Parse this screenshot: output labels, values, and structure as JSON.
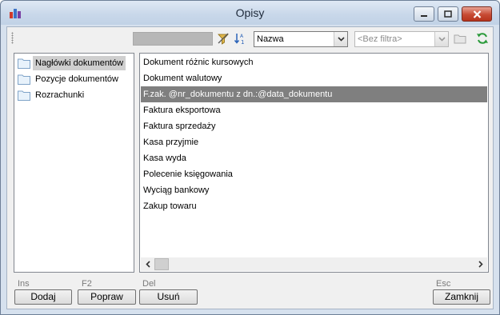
{
  "window": {
    "title": "Opisy",
    "icons": {
      "app": "bar-chart-app-icon",
      "minimize": "minimize-icon",
      "maximize": "maximize-icon",
      "close": "close-icon"
    }
  },
  "toolbar": {
    "sort_field_value": "Nazwa",
    "filter_value": "<Bez filtra>",
    "icons": [
      "filter-clear-icon",
      "sort-ascending-icon",
      "folder-icon",
      "refresh-icon"
    ]
  },
  "tree": {
    "items": [
      {
        "label": "Nagłówki dokumentów",
        "selected": true
      },
      {
        "label": "Pozycje dokumentów",
        "selected": false
      },
      {
        "label": "Rozrachunki",
        "selected": false
      }
    ]
  },
  "list": {
    "items": [
      {
        "label": "Dokument różnic kursowych",
        "selected": false
      },
      {
        "label": "Dokument walutowy",
        "selected": false
      },
      {
        "label": "F.zak. @nr_dokumentu z dn.:@data_dokumentu",
        "selected": true
      },
      {
        "label": "Faktura eksportowa",
        "selected": false
      },
      {
        "label": "Faktura sprzedaży",
        "selected": false
      },
      {
        "label": "Kasa przyjmie",
        "selected": false
      },
      {
        "label": "Kasa wyda",
        "selected": false
      },
      {
        "label": "Polecenie  księgowania",
        "selected": false
      },
      {
        "label": "Wyciąg bankowy",
        "selected": false
      },
      {
        "label": "Zakup towaru",
        "selected": false
      }
    ]
  },
  "buttons": {
    "add": {
      "label": "Dodaj",
      "shortcut": "Ins"
    },
    "edit": {
      "label": "Popraw",
      "shortcut": "F2"
    },
    "delete": {
      "label": "Usuń",
      "shortcut": "Del"
    },
    "close": {
      "label": "Zamknij",
      "shortcut": "Esc"
    }
  },
  "colors": {
    "selection": "#7f7f7f",
    "titlebar": "#c9d8ea",
    "close_button": "#c74a33"
  }
}
